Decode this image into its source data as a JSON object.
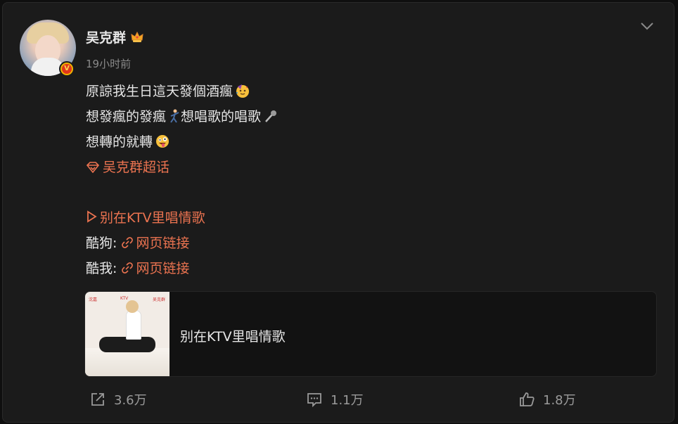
{
  "post": {
    "author": "吴克群",
    "time": "19小时前",
    "lines": {
      "l1": "原諒我生日這天發個酒瘋",
      "l2a": "想發瘋的發瘋",
      "l2b": "想唱歌的唱歌",
      "l3": "想轉的就轉",
      "topic": "吴克群超话",
      "song": "别在KTV里唱情歌",
      "kugou_label": "酷狗:",
      "kuwo_label": "酷我:",
      "link_text": "网页链接"
    },
    "media": {
      "title": "别在KTV里唱情歌",
      "cover_text": [
        "沈嘉",
        "KTV",
        "吴克群"
      ]
    },
    "stats": {
      "repost": "3.6万",
      "comment": "1.1万",
      "like": "1.8万"
    }
  },
  "icons": {
    "avatar_badge": "verified-v-badge",
    "crown": "crown-icon",
    "more": "chevron-down-icon",
    "repost": "share-icon",
    "comment": "comment-icon",
    "like": "thumbs-up-icon"
  },
  "colors": {
    "link": "#eb7350",
    "badge": "#f0b400"
  }
}
